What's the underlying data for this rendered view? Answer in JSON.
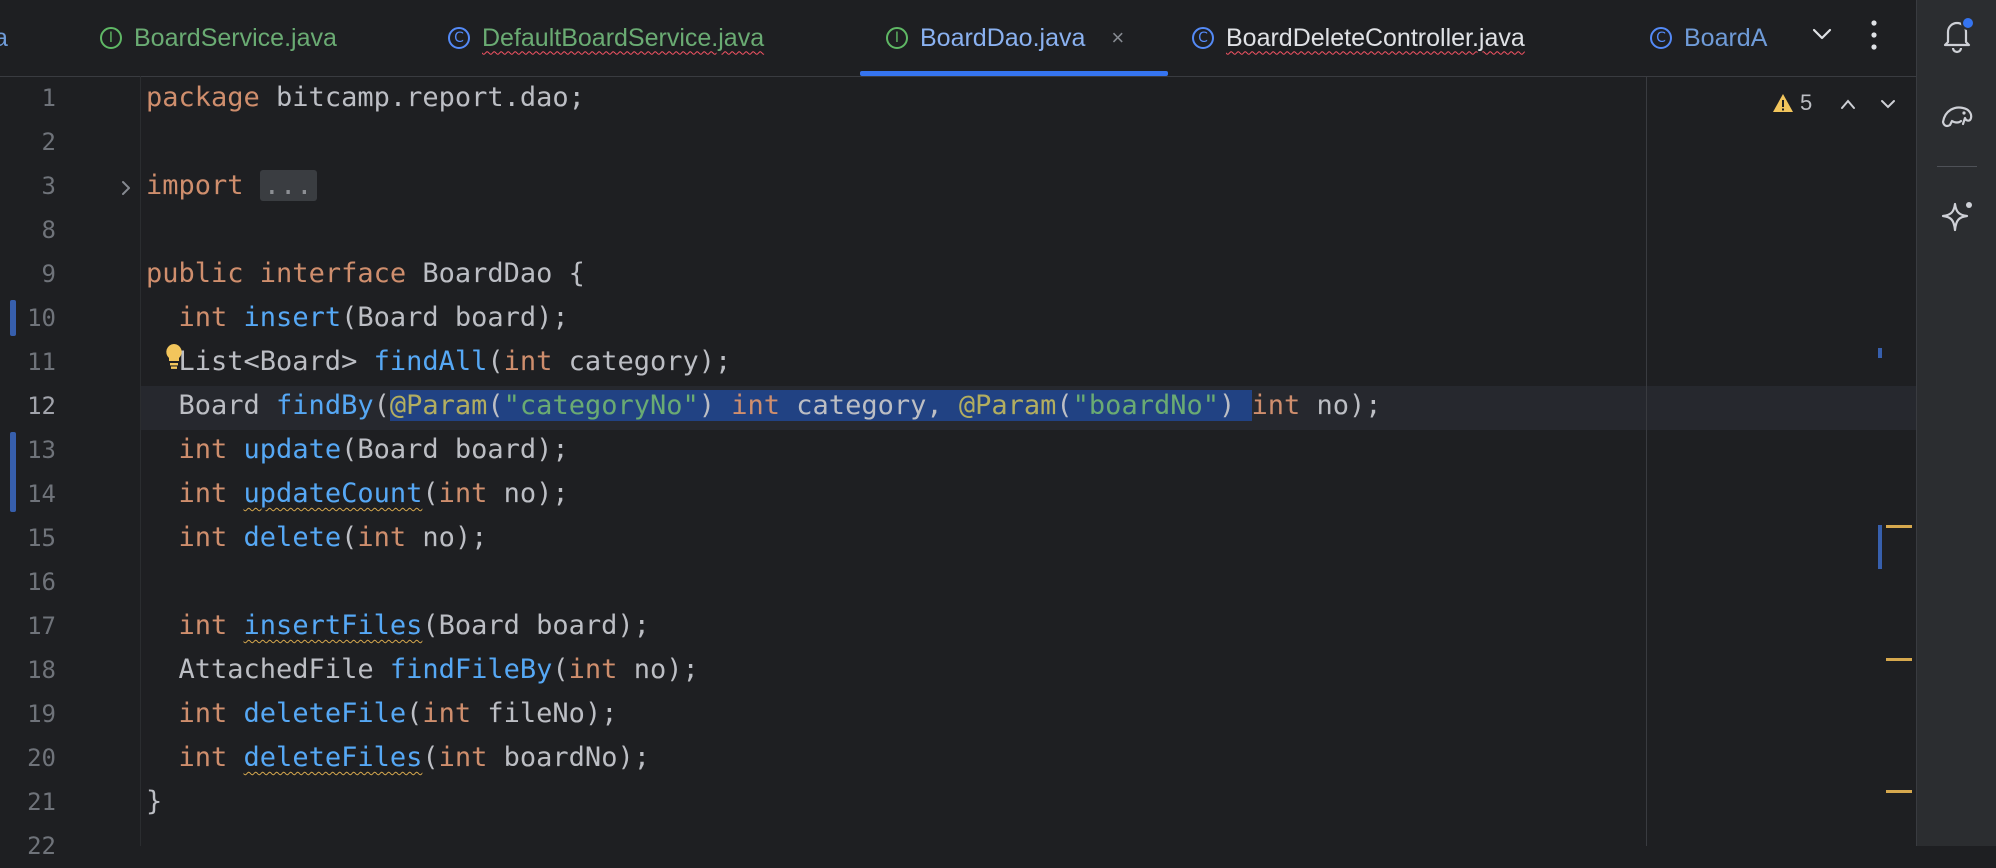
{
  "tabs": [
    {
      "icon": "I",
      "label": "BoardService.java",
      "style": "green",
      "underline": false,
      "active": false,
      "partial": false
    },
    {
      "icon": "C",
      "label": "DefaultBoardService.java",
      "style": "green",
      "underline": true,
      "active": false,
      "partial": false
    },
    {
      "icon": "I",
      "label": "BoardDao.java",
      "style": "active",
      "underline": false,
      "active": true,
      "partial": false
    },
    {
      "icon": "C",
      "label": "BoardDeleteController.java",
      "style": "white",
      "underline": true,
      "active": false,
      "partial": false
    },
    {
      "icon": "C",
      "label": "BoardA",
      "style": "blue",
      "underline": false,
      "active": false,
      "partial": true
    }
  ],
  "tab_left_partial": "a",
  "tab_close_glyph": "×",
  "inspection": {
    "warning_count": "5"
  },
  "editor": {
    "active_line": "12",
    "lines": [
      {
        "n": "1",
        "tokens": [
          {
            "t": "package ",
            "c": "kw"
          },
          {
            "t": "bitcamp.report.dao;",
            "c": ""
          }
        ]
      },
      {
        "n": "2",
        "tokens": []
      },
      {
        "n": "3",
        "tokens": [
          {
            "t": "import ",
            "c": "kw"
          },
          {
            "t": "...",
            "c": "fold"
          }
        ]
      },
      {
        "n": "8",
        "tokens": []
      },
      {
        "n": "9",
        "tokens": [
          {
            "t": "public ",
            "c": "kw"
          },
          {
            "t": "interface ",
            "c": "kw"
          },
          {
            "t": "BoardDao {",
            "c": ""
          }
        ]
      },
      {
        "n": "10",
        "tokens": [
          {
            "t": "  ",
            "c": ""
          },
          {
            "t": "int ",
            "c": "kw"
          },
          {
            "t": "insert",
            "c": "fn"
          },
          {
            "t": "(Board board);",
            "c": ""
          }
        ]
      },
      {
        "n": "11",
        "tokens": [
          {
            "t": "  List<Board> ",
            "c": ""
          },
          {
            "t": "findAll",
            "c": "fn"
          },
          {
            "t": "(",
            "c": ""
          },
          {
            "t": "int ",
            "c": "kw"
          },
          {
            "t": "category);",
            "c": ""
          }
        ]
      },
      {
        "n": "12",
        "tokens": [
          {
            "t": "  Board ",
            "c": ""
          },
          {
            "t": "findBy",
            "c": "fn"
          },
          {
            "t": "(",
            "c": ""
          },
          {
            "t": "@Param",
            "c": "an sel"
          },
          {
            "t": "(",
            "c": "sel"
          },
          {
            "t": "\"categoryNo\"",
            "c": "st sel"
          },
          {
            "t": ") ",
            "c": "sel"
          },
          {
            "t": "int ",
            "c": "kw sel"
          },
          {
            "t": "category, ",
            "c": "sel"
          },
          {
            "t": "@Param",
            "c": "an sel"
          },
          {
            "t": "(",
            "c": "sel"
          },
          {
            "t": "\"boardNo\"",
            "c": "st sel"
          },
          {
            "t": ") ",
            "c": "sel"
          },
          {
            "t": "int ",
            "c": "kw"
          },
          {
            "t": "no);",
            "c": ""
          }
        ]
      },
      {
        "n": "13",
        "tokens": [
          {
            "t": "  ",
            "c": ""
          },
          {
            "t": "int ",
            "c": "kw"
          },
          {
            "t": "update",
            "c": "fn"
          },
          {
            "t": "(Board board);",
            "c": ""
          }
        ]
      },
      {
        "n": "14",
        "tokens": [
          {
            "t": "  ",
            "c": ""
          },
          {
            "t": "int ",
            "c": "kw"
          },
          {
            "t": "updateCount",
            "c": "fn wavy-y"
          },
          {
            "t": "(",
            "c": ""
          },
          {
            "t": "int ",
            "c": "kw"
          },
          {
            "t": "no);",
            "c": ""
          }
        ]
      },
      {
        "n": "15",
        "tokens": [
          {
            "t": "  ",
            "c": ""
          },
          {
            "t": "int ",
            "c": "kw"
          },
          {
            "t": "delete",
            "c": "fn"
          },
          {
            "t": "(",
            "c": ""
          },
          {
            "t": "int ",
            "c": "kw"
          },
          {
            "t": "no);",
            "c": ""
          }
        ]
      },
      {
        "n": "16",
        "tokens": []
      },
      {
        "n": "17",
        "tokens": [
          {
            "t": "  ",
            "c": ""
          },
          {
            "t": "int ",
            "c": "kw"
          },
          {
            "t": "insertFiles",
            "c": "fn wavy-y"
          },
          {
            "t": "(Board board);",
            "c": ""
          }
        ]
      },
      {
        "n": "18",
        "tokens": [
          {
            "t": "  AttachedFile ",
            "c": ""
          },
          {
            "t": "findFileBy",
            "c": "fn"
          },
          {
            "t": "(",
            "c": ""
          },
          {
            "t": "int ",
            "c": "kw"
          },
          {
            "t": "no);",
            "c": ""
          }
        ]
      },
      {
        "n": "19",
        "tokens": [
          {
            "t": "  ",
            "c": ""
          },
          {
            "t": "int ",
            "c": "kw"
          },
          {
            "t": "deleteFile",
            "c": "fn"
          },
          {
            "t": "(",
            "c": ""
          },
          {
            "t": "int ",
            "c": "kw"
          },
          {
            "t": "fileNo);",
            "c": ""
          }
        ]
      },
      {
        "n": "20",
        "tokens": [
          {
            "t": "  ",
            "c": ""
          },
          {
            "t": "int ",
            "c": "kw"
          },
          {
            "t": "deleteFiles",
            "c": "fn wavy-y"
          },
          {
            "t": "(",
            "c": ""
          },
          {
            "t": "int ",
            "c": "kw"
          },
          {
            "t": "boardNo);",
            "c": ""
          }
        ]
      },
      {
        "n": "21",
        "tokens": [
          {
            "t": "}",
            "c": ""
          }
        ]
      },
      {
        "n": "22",
        "tokens": []
      }
    ]
  },
  "icons": {
    "notifications": "bell-icon",
    "database": "database-icon",
    "ai_assistant": "sparkle-icon",
    "warning": "warning-icon",
    "bulb": "lightbulb-icon"
  },
  "colors": {
    "background": "#1e1f22",
    "keyword": "#cf8e6d",
    "function": "#56a8f5",
    "annotation": "#b3ae60",
    "string": "#6aab73",
    "selection": "#214283",
    "active_tab_underline": "#3574f0",
    "warning": "#f2c55c"
  }
}
